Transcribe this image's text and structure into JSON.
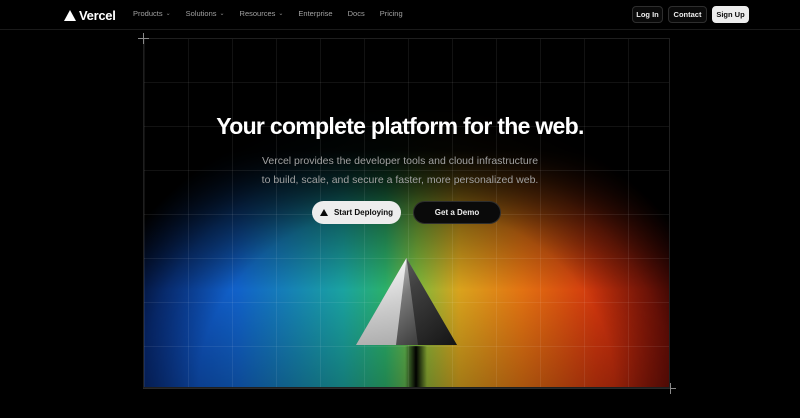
{
  "brand": {
    "name": "Vercel",
    "logo_icon": "vercel-triangle-icon"
  },
  "nav": {
    "items": [
      {
        "label": "Products",
        "has_dropdown": true
      },
      {
        "label": "Solutions",
        "has_dropdown": true
      },
      {
        "label": "Resources",
        "has_dropdown": true
      },
      {
        "label": "Enterprise",
        "has_dropdown": false
      },
      {
        "label": "Docs",
        "has_dropdown": false
      },
      {
        "label": "Pricing",
        "has_dropdown": false
      }
    ],
    "login_label": "Log In",
    "contact_label": "Contact",
    "signup_label": "Sign Up"
  },
  "hero": {
    "title": "Your complete platform for the web.",
    "subtitle_line1": "Vercel provides the developer tools and cloud infrastructure",
    "subtitle_line2": "to build, scale, and secure a faster, more personalized web.",
    "primary_cta": "Start Deploying",
    "secondary_cta": "Get a Demo"
  },
  "colors": {
    "background": "#000000",
    "text_primary": "#ffffff",
    "text_secondary": "#a1a1a1",
    "gradient": [
      "#0b3fb0",
      "#1aa3a0",
      "#2bb06a",
      "#d9a31d",
      "#e27212",
      "#a9160a"
    ]
  }
}
